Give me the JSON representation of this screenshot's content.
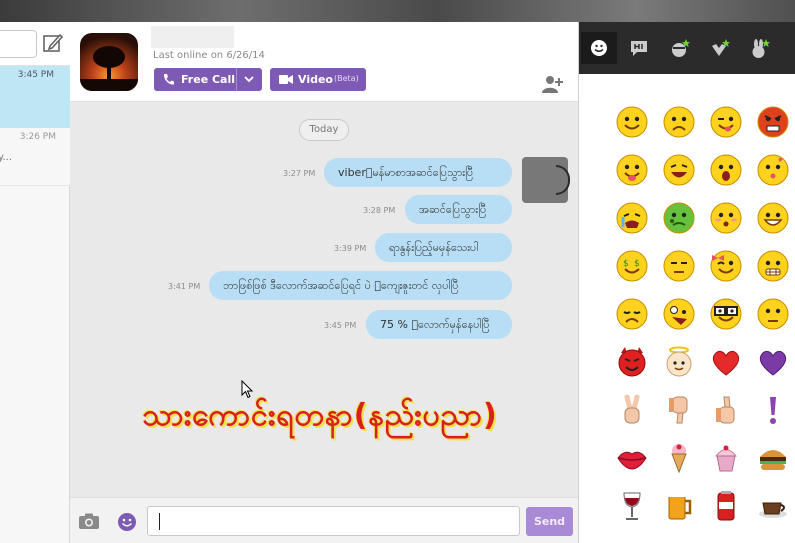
{
  "left_panel": {
    "conversations": [
      {
        "time": "3:45 PM",
        "snippet": "",
        "selected": true
      },
      {
        "time": "3:26 PM",
        "snippet": "y...",
        "selected": false
      }
    ]
  },
  "header": {
    "last_online": "Last online on 6/26/14",
    "free_call_label": "Free Call",
    "video_label": "Video",
    "video_badge": "(Beta)"
  },
  "chat": {
    "date_divider": "Today",
    "messages": [
      {
        "time": "3:27 PM",
        "text": "viber􀀀မန်မာစာအဆင်ပြေသွားပြီ"
      },
      {
        "time": "3:28 PM",
        "text": "အဆင်ပြေသွားပြီ"
      },
      {
        "time": "3:39 PM",
        "text": "ရာနွန်းပြည့်မမှန်သေးပါ"
      },
      {
        "time": "3:41 PM",
        "text": "ဘာဖြစ်ဖြစ် ဒီလောက်အဆင်ပြေရင် ပဲ 􀀀ကျေးဇူးတင် လှပါပြီ"
      },
      {
        "time": "3:45 PM",
        "text": "75 % 􀀀လောက်မှန်နေပါပြီ"
      }
    ],
    "watermark": "သားကောင်းရတနာ(နည်းပညာ)"
  },
  "composer": {
    "input_value": "",
    "send_label": "Send"
  },
  "emoji_panel": {
    "tabs": [
      "smiley-tab-icon",
      "hi-sticker-tab-icon",
      "sticker-pack-new-icon",
      "heart-sticker-new-icon",
      "bunny-sticker-new-icon"
    ],
    "rows": [
      [
        "smile",
        "worried",
        "wink-tongue",
        "angry"
      ],
      [
        "tongue-out",
        "laughing",
        "shocked",
        "kiss"
      ],
      [
        "crying",
        "sick",
        "embarrassed",
        "grin"
      ],
      [
        "money-eyes",
        "suspicious",
        "wink-bow",
        "nervous"
      ],
      [
        "sad",
        "crazy",
        "nerd-glasses",
        "thinking"
      ],
      [
        "devil",
        "angel",
        "red-heart",
        "purple-heart"
      ],
      [
        "peace-hand",
        "thumbs-down",
        "thumbs-up",
        "exclamation"
      ],
      [
        "lips",
        "ice-cream",
        "cupcake",
        "burger"
      ],
      [
        "wine",
        "beer",
        "soda-can",
        "coffee-cup"
      ]
    ]
  },
  "colors": {
    "viber_purple": "#7d5ab3",
    "bubble_blue": "#b7def4",
    "watermark_red": "#d91f1f",
    "watermark_yellow": "#f2e24a"
  }
}
